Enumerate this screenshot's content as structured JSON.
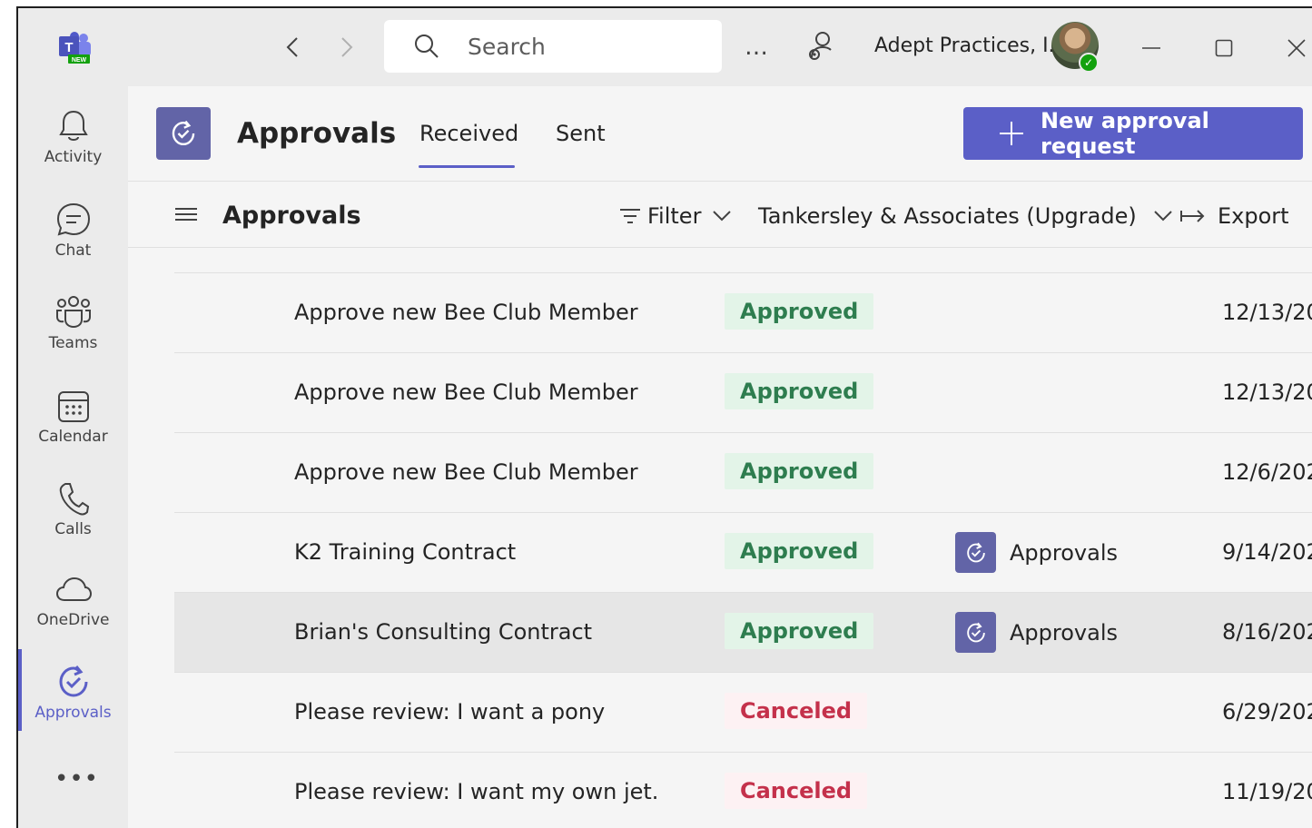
{
  "titlebar": {
    "search_placeholder": "Search",
    "more": "…",
    "org_name": "Adept Practices, I...",
    "presence": "✓",
    "app_logo_badge": "NEW"
  },
  "rail": {
    "items": [
      {
        "label": "Activity",
        "icon": "bell-icon"
      },
      {
        "label": "Chat",
        "icon": "chat-icon"
      },
      {
        "label": "Teams",
        "icon": "teams-icon"
      },
      {
        "label": "Calendar",
        "icon": "calendar-icon"
      },
      {
        "label": "Calls",
        "icon": "phone-icon"
      },
      {
        "label": "OneDrive",
        "icon": "cloud-icon"
      },
      {
        "label": "Approvals",
        "icon": "approvals-icon",
        "active": true
      }
    ],
    "more": "•••"
  },
  "header": {
    "title": "Approvals",
    "tabs": [
      {
        "label": "Received",
        "selected": true
      },
      {
        "label": "Sent",
        "selected": false
      }
    ],
    "new_button_label": "New approval request"
  },
  "toolbar": {
    "title": "Approvals",
    "filter_label": "Filter",
    "org_label": "Tankersley & Associates (Upgrade)",
    "export_label": "Export"
  },
  "rows": [
    {
      "title": "Approve new Bee Club Member",
      "status": "Approved",
      "source": "",
      "date": "12/13/20"
    },
    {
      "title": "Approve new Bee Club Member",
      "status": "Approved",
      "source": "",
      "date": "12/13/20"
    },
    {
      "title": "Approve new Bee Club Member",
      "status": "Approved",
      "source": "",
      "date": "12/6/202"
    },
    {
      "title": "K2 Training Contract",
      "status": "Approved",
      "source": "Approvals",
      "date": "9/14/202"
    },
    {
      "title": "Brian's Consulting Contract",
      "status": "Approved",
      "source": "Approvals",
      "date": "8/16/202"
    },
    {
      "title": "Please review: I want a pony",
      "status": "Canceled",
      "source": "",
      "date": "6/29/202"
    },
    {
      "title": "Please review: I want my own jet.",
      "status": "Canceled",
      "source": "",
      "date": "11/19/20"
    }
  ],
  "colors": {
    "accent": "#5b5fc7",
    "tile": "#6264a7",
    "approved_text": "#2e7d4f",
    "approved_bg": "#e3f4e8",
    "canceled_text": "#c4314b",
    "canceled_bg": "#fdf1f3"
  }
}
